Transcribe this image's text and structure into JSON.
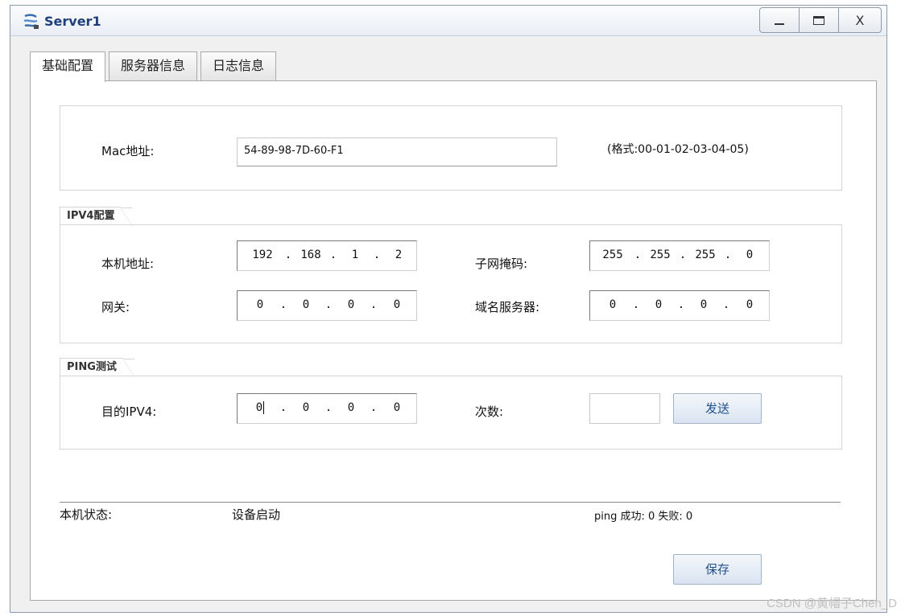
{
  "window": {
    "title": "Server1",
    "controls": {
      "minimize": "minimize",
      "maximize": "maximize",
      "close": "X"
    }
  },
  "tabs": [
    {
      "label": "基础配置",
      "active": true
    },
    {
      "label": "服务器信息",
      "active": false
    },
    {
      "label": "日志信息",
      "active": false
    }
  ],
  "mac": {
    "label": "Mac地址:",
    "value": "54-89-98-7D-60-F1",
    "format_hint": "(格式:00-01-02-03-04-05)"
  },
  "ipv4": {
    "section_title": "IPV4配置",
    "local_address": {
      "label": "本机地址:",
      "octets": [
        "192",
        "168",
        "1",
        "2"
      ]
    },
    "subnet_mask": {
      "label": "子网掩码:",
      "octets": [
        "255",
        "255",
        "255",
        "0"
      ]
    },
    "gateway": {
      "label": "网关:",
      "octets": [
        "0",
        "0",
        "0",
        "0"
      ]
    },
    "dns": {
      "label": "域名服务器:",
      "octets": [
        "0",
        "0",
        "0",
        "0"
      ]
    }
  },
  "ping": {
    "section_title": "PING测试",
    "dest_label": "目的IPV4:",
    "dest_octets": [
      "0",
      "0",
      "0",
      "0"
    ],
    "count_label": "次数:",
    "count_value": "",
    "send_label": "发送"
  },
  "status": {
    "label": "本机状态:",
    "value": "设备启动",
    "ping_result": "ping 成功: 0 失败: 0"
  },
  "save_label": "保存",
  "watermark": "CSDN @黄帽子Chen_D",
  "colors": {
    "title": "#1f3f7a",
    "button_text": "#1f4f8a",
    "button_border": "#9eb3cc"
  }
}
